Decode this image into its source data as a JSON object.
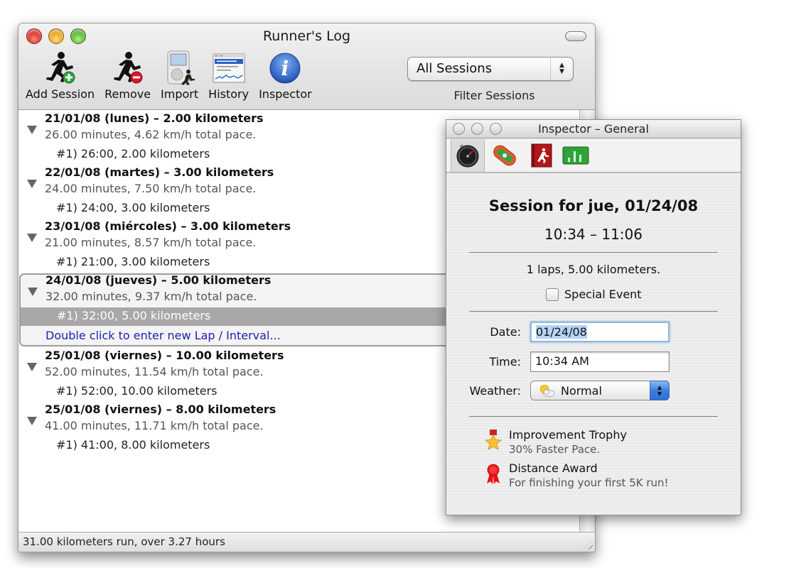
{
  "window": {
    "title": "Runner's Log"
  },
  "toolbar": {
    "items": [
      {
        "label": "Add Session",
        "icon": "runner-add-icon"
      },
      {
        "label": "Remove",
        "icon": "runner-remove-icon"
      },
      {
        "label": "Import",
        "icon": "ipod-import-icon"
      },
      {
        "label": "History",
        "icon": "history-window-icon"
      },
      {
        "label": "Inspector",
        "icon": "info-icon"
      }
    ],
    "filter": {
      "selected": "All Sessions",
      "caption": "Filter Sessions"
    }
  },
  "sessions": [
    {
      "title": "21/01/08 (lunes) – 2.00 kilometers",
      "summary": "26.00 minutes, 4.62 km/h total pace.",
      "laps": [
        "#1) 26:00, 2.00 kilometers"
      ]
    },
    {
      "title": "22/01/08 (martes) – 3.00 kilometers",
      "summary": "24.00 minutes, 7.50 km/h total pace.",
      "laps": [
        "#1) 24:00, 3.00 kilometers"
      ]
    },
    {
      "title": "23/01/08 (miércoles) – 3.00 kilometers",
      "summary": "21.00 minutes, 8.57 km/h total pace.",
      "laps": [
        "#1) 21:00, 3.00 kilometers"
      ]
    },
    {
      "title": "24/01/08 (jueves) – 5.00 kilometers",
      "summary": "32.00 minutes, 9.37 km/h total pace.",
      "laps": [
        "#1) 32:00, 5.00 kilometers"
      ],
      "selected": true,
      "add_lap_hint": "Double click to enter new Lap / Interval..."
    },
    {
      "title": "25/01/08 (viernes) – 10.00 kilometers",
      "summary": "52.00 minutes, 11.54 km/h total pace.",
      "laps": [
        "#1) 52:00, 10.00 kilometers"
      ]
    },
    {
      "title": "25/01/08 (viernes) – 8.00 kilometers",
      "summary": "41.00 minutes, 11.71 km/h total pace.",
      "laps": [
        "#1) 41:00, 8.00 kilometers"
      ]
    }
  ],
  "status": {
    "text": "31.00 kilometers run, over 3.27 hours"
  },
  "inspector": {
    "title": "Inspector – General",
    "tabs": [
      {
        "name": "general",
        "icon": "stopwatch-icon",
        "active": true
      },
      {
        "name": "track",
        "icon": "track-icon"
      },
      {
        "name": "log",
        "icon": "runner-book-icon"
      },
      {
        "name": "stats",
        "icon": "bar-chart-icon"
      }
    ],
    "heading": "Session for jue, 01/24/08",
    "time_range": "10:34 – 11:06",
    "laps_summary": "1 laps, 5.00 kilometers.",
    "special_event": {
      "label": "Special Event",
      "checked": false
    },
    "date": {
      "label": "Date:",
      "value": "01/24/08"
    },
    "time": {
      "label": "Time:",
      "value": "10:34 AM"
    },
    "weather": {
      "label": "Weather:",
      "value": "Normal",
      "icon": "partly-sunny-icon"
    },
    "awards": [
      {
        "title": "Improvement Trophy",
        "description": "30% Faster Pace.",
        "icon": "star-trophy-icon"
      },
      {
        "title": "Distance Award",
        "description": "For finishing your first 5K run!",
        "icon": "ribbon-award-icon"
      }
    ]
  }
}
